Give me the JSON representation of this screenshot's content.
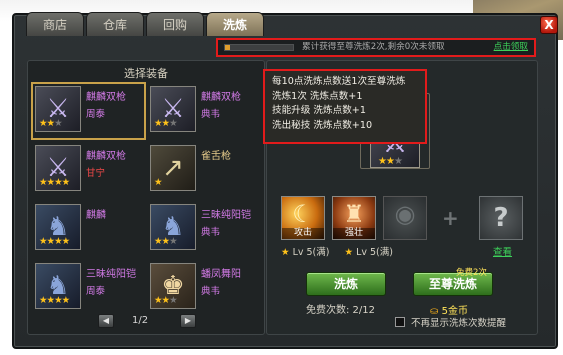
{
  "tabs": [
    {
      "label": "商店",
      "active": false
    },
    {
      "label": "仓库",
      "active": false
    },
    {
      "label": "回购",
      "active": false
    },
    {
      "label": "洗炼",
      "active": true
    }
  ],
  "close_label": "X",
  "notice": {
    "progress": 0.08,
    "message": "累计获得至尊洗炼2次,剩余0次未领取",
    "claim_label": "点击领取"
  },
  "left_panel": {
    "title": "选择装备",
    "items": [
      {
        "name": "麒麟双枪",
        "owner": "周泰",
        "stars": 2,
        "max_stars": 3,
        "icon": "halberd-icon",
        "selected": true,
        "owner_color": "purple"
      },
      {
        "name": "麒麟双枪",
        "owner": "典韦",
        "stars": 2,
        "max_stars": 3,
        "icon": "halberd-icon",
        "selected": false,
        "owner_color": "purple"
      },
      {
        "name": "麒麟双枪",
        "owner": "甘宁",
        "stars": 4,
        "max_stars": 4,
        "icon": "halberd-icon",
        "selected": false,
        "owner_color": "red"
      },
      {
        "name": "雀舌枪",
        "owner": "",
        "stars": 1,
        "max_stars": 1,
        "icon": "spear-icon",
        "selected": false,
        "owner_color": "purple",
        "name_color": "gold"
      },
      {
        "name": "麒麟",
        "owner": "",
        "stars": 4,
        "max_stars": 4,
        "icon": "armor-icon",
        "selected": false,
        "owner_color": "purple"
      },
      {
        "name": "三昧纯阳铠",
        "owner": "典韦",
        "stars": 2,
        "max_stars": 3,
        "icon": "armor-icon",
        "selected": false,
        "owner_color": "purple"
      },
      {
        "name": "三昧纯阳铠",
        "owner": "周泰",
        "stars": 4,
        "max_stars": 4,
        "icon": "armor-icon",
        "selected": false,
        "owner_color": "purple"
      },
      {
        "name": "蟠凤舞阳",
        "owner": "典韦",
        "stars": 2,
        "max_stars": 3,
        "icon": "robe-icon",
        "selected": false,
        "owner_color": "purple"
      }
    ],
    "pager": {
      "label": "1/2",
      "prev": "◀",
      "next": "▶"
    }
  },
  "tooltip": {
    "lines": [
      "每10点洗炼点数送1次至尊洗炼",
      "洗炼1次  洗炼点数+1",
      "技能升级  洗炼点数+1",
      "洗出秘技  洗炼点数+10"
    ]
  },
  "preview": {
    "stars": 2,
    "max_stars": 3,
    "icon": "halberd-icon"
  },
  "skills": [
    {
      "name": "攻击",
      "level": "Lv 5(满)",
      "icon": "slash-icon"
    },
    {
      "name": "强壮",
      "level": "Lv 5(满)",
      "icon": "warrior-icon"
    }
  ],
  "view_link": "查看",
  "buttons": {
    "wash": "洗炼",
    "supreme": "至尊洗炼",
    "free_badge": "免费2次"
  },
  "free_count": "免费次数: 2/12",
  "gold_cost": "5金币",
  "no_remind": "不再显示洗炼次数提醒",
  "colors": {
    "highlight_box": "#e21b1b",
    "claim_link": "#3dd15a",
    "star": "#ffc21a",
    "purple_text": "#d27ae6"
  }
}
